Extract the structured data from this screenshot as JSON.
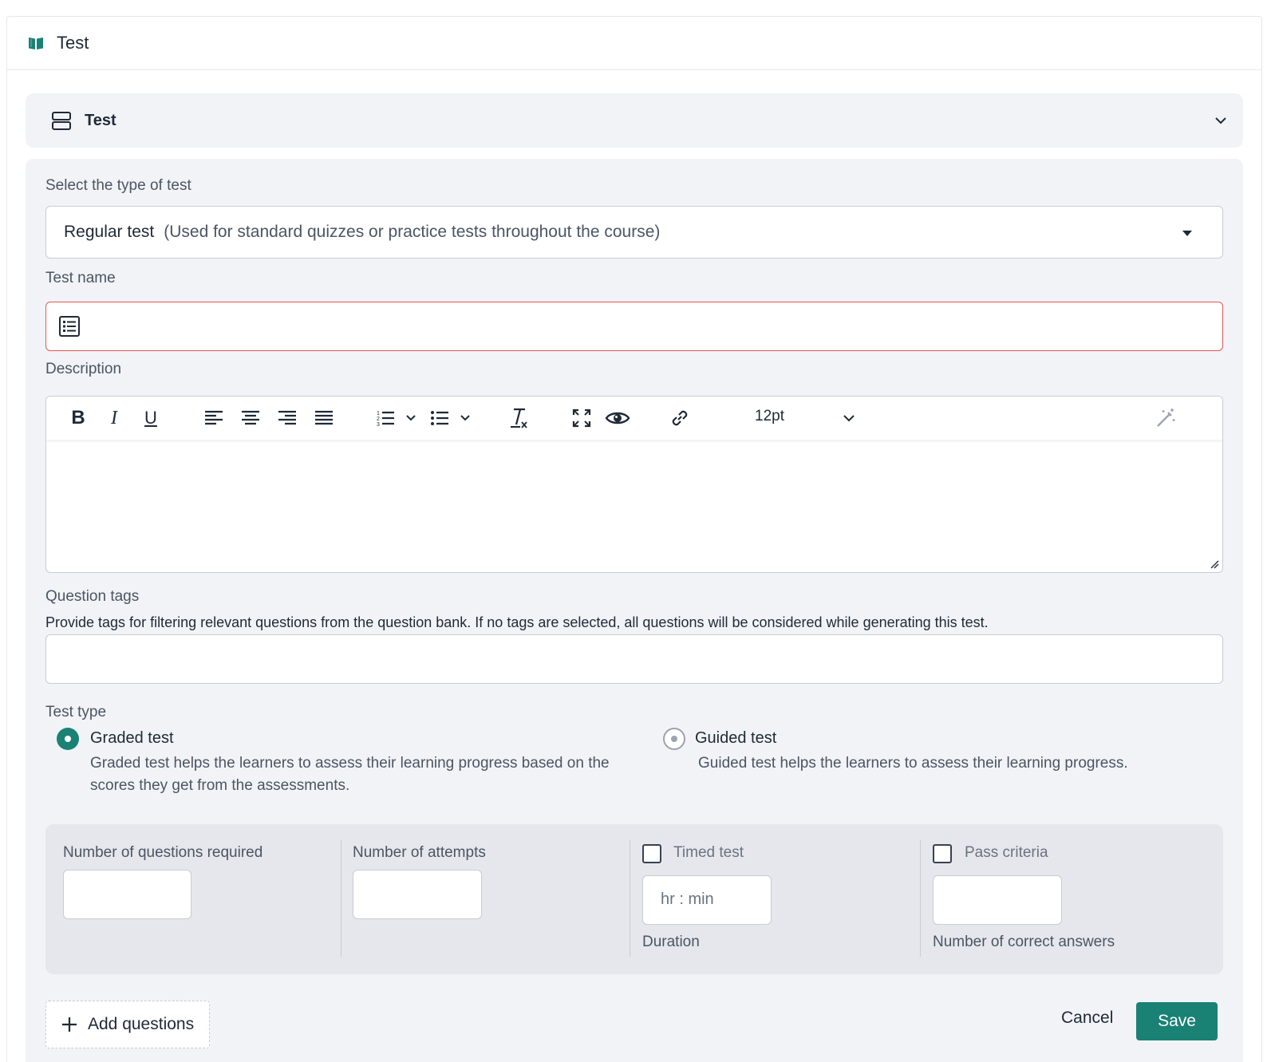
{
  "header": {
    "title": "Test",
    "icon": "book-icon",
    "accent": "#1a8175"
  },
  "section": {
    "title": "Test",
    "icon": "stack-icon"
  },
  "form": {
    "type_label": "Select the type of test",
    "type_value": "Regular test",
    "type_hint": "(Used for standard quizzes or practice tests throughout the course)",
    "name_label": "Test name",
    "name_value": "",
    "description_label": "Description",
    "font_size": "12pt",
    "tags_label": "Question tags",
    "tags_help": "Provide tags for filtering relevant questions from the question bank. If no tags are selected, all questions will be considered while generating this test.",
    "tags_value": "",
    "test_type_label": "Test type",
    "graded": {
      "title": "Graded test",
      "desc": "Graded test helps the learners to assess their learning progress based on the scores they get from the assessments.",
      "selected": true
    },
    "guided": {
      "title": "Guided test",
      "desc": "Guided test helps the learners to assess their learning progress.",
      "selected": false
    },
    "settings": {
      "questions_label": "Number of questions required",
      "questions_value": "",
      "attempts_label": "Number of attempts",
      "attempts_value": "",
      "timed_label": "Timed test",
      "timed_checked": false,
      "duration_placeholder": "hr : min",
      "duration_label": "Duration",
      "pass_label": "Pass criteria",
      "pass_checked": false,
      "correct_label": "Number of correct answers"
    }
  },
  "actions": {
    "add_questions": "Add questions",
    "cancel": "Cancel",
    "save": "Save",
    "save_color": "#1a8175"
  }
}
